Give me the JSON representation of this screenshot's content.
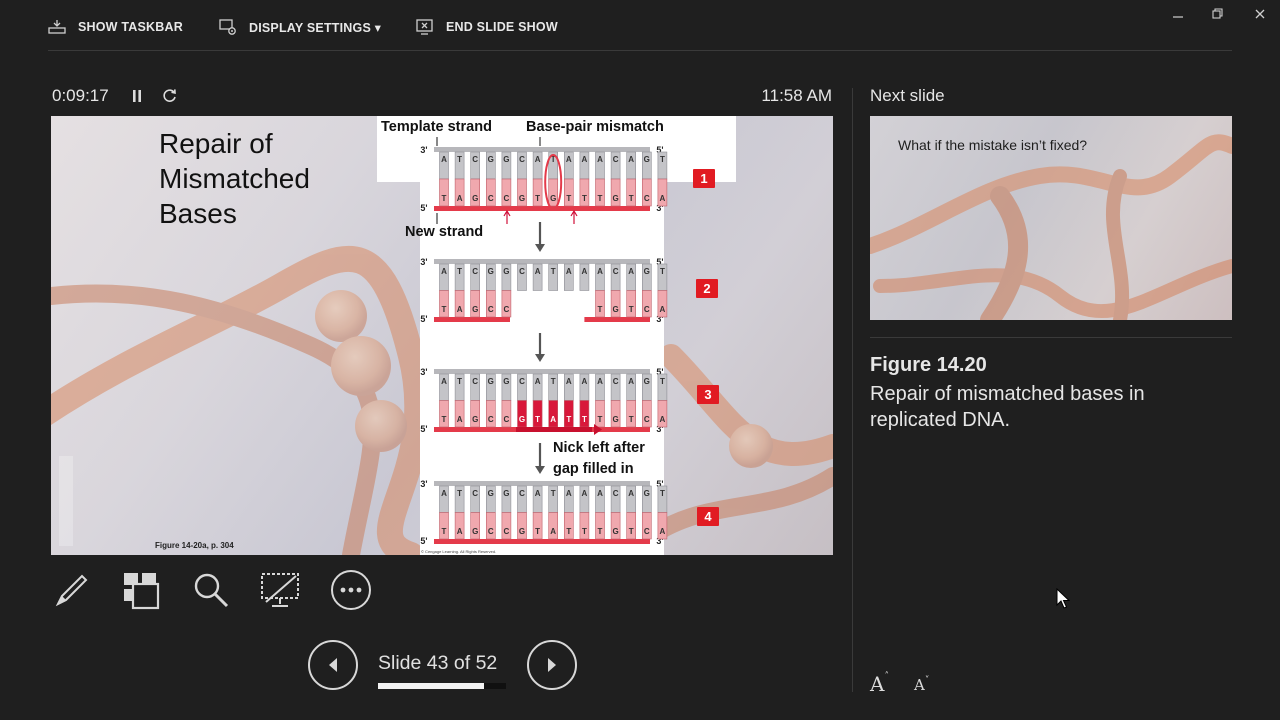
{
  "toolbar": {
    "show_taskbar": "SHOW TASKBAR",
    "display_settings": "DISPLAY SETTINGS ▾",
    "end_slide_show": "END SLIDE SHOW"
  },
  "header": {
    "timer": "0:09:17",
    "clock": "11:58 AM"
  },
  "current_slide": {
    "title_lines": [
      "Repair of",
      "Mismatched",
      "Bases"
    ],
    "figure_caption": "Figure 14-20a, p. 304",
    "copyright": "© Cengage Learning. All Rights Reserved.",
    "labels": {
      "template_strand": "Template strand",
      "mismatch": "Base-pair mismatch",
      "new_strand": "New strand",
      "nick_line1": "Nick left after",
      "nick_line2": "gap filled in"
    },
    "prime_3": "3'",
    "prime_5": "5'",
    "top_bases": [
      "A",
      "T",
      "C",
      "G",
      "G",
      "C",
      "A",
      "T",
      "A",
      "A",
      "A",
      "C",
      "A",
      "G",
      "T"
    ],
    "bottom_bases": [
      "T",
      "A",
      "G",
      "C",
      "C",
      "G",
      "T",
      "A",
      "T",
      "T",
      "T",
      "G",
      "T",
      "C",
      "A"
    ],
    "mismatch_bottom_base": "G",
    "step_badges": [
      "1",
      "2",
      "3",
      "4"
    ]
  },
  "navigation": {
    "slide_counter": "Slide 43 of 52",
    "progress": 0.83
  },
  "next_pane": {
    "label": "Next slide",
    "next_slide_text": "What if the mistake isn’t fixed?"
  },
  "notes": {
    "title": "Figure 14.20",
    "body": "Repair of mismatched bases in replicated DNA."
  },
  "font_controls": {
    "increase": "A",
    "decrease": "A"
  },
  "colors": {
    "background": "#1f1f1f",
    "strand_red": "#e43a4a",
    "badge_red": "#e11b22"
  }
}
